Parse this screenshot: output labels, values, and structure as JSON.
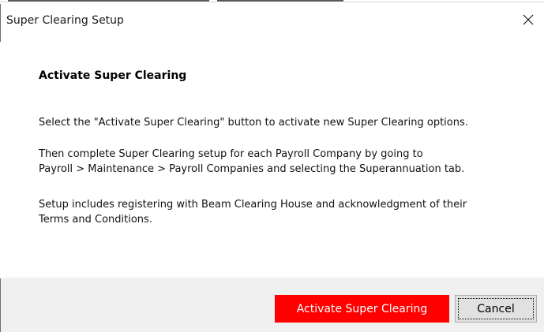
{
  "window": {
    "title": "Super Clearing Setup",
    "close_icon": "close-icon"
  },
  "content": {
    "heading": "Activate Super Clearing",
    "paragraph1": "Select the \"Activate Super Clearing\" button to activate new Super Clearing options.",
    "paragraph2_line1": "Then complete Super Clearing setup for each Payroll Company by going to",
    "paragraph2_line2": "Payroll > Maintenance > Payroll Companies and selecting the Superannuation tab.",
    "paragraph3_line1": "Setup includes registering with Beam Clearing House and acknowledgment of their",
    "paragraph3_line2": "Terms and Conditions."
  },
  "footer": {
    "activate_label": "Activate Super Clearing",
    "cancel_label": "Cancel"
  },
  "colors": {
    "primary_button": "#ff0000",
    "footer_background": "#f0f0f0"
  }
}
